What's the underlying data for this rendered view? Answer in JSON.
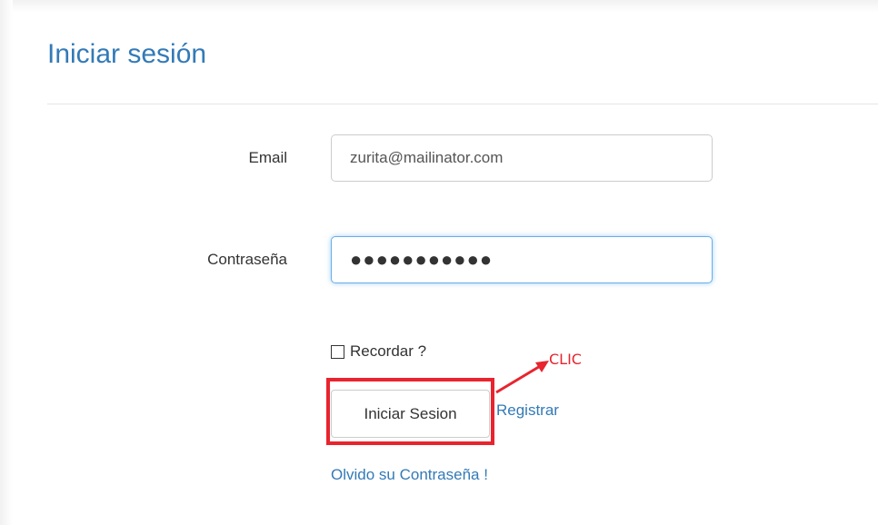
{
  "page": {
    "title": "Iniciar sesión"
  },
  "form": {
    "email_label": "Email",
    "email_value": "zurita@mailinator.com",
    "password_label": "Contraseña",
    "password_value": "●●●●●●●●●●●",
    "remember_label": "Recordar ?",
    "remember_checked": false,
    "submit_label": "Iniciar Sesion",
    "register_label": "Registrar",
    "forgot_label": "Olvido su Contraseña !"
  },
  "annotation": {
    "label": "CLIC",
    "color": "#e8242e"
  },
  "colors": {
    "accent": "#337ab7",
    "focus": "#66afe9",
    "highlight": "#e8242e"
  }
}
